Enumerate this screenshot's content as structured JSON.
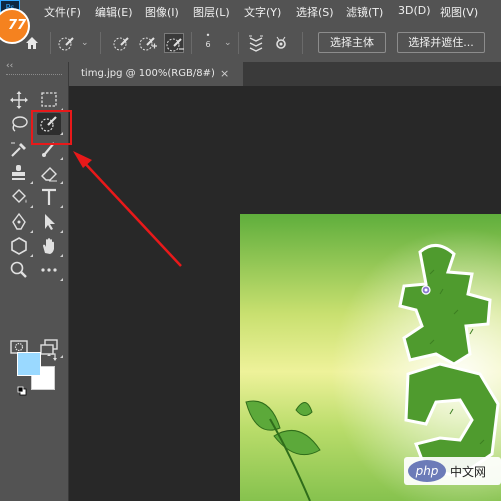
{
  "app": {
    "logo_text": "Ps",
    "badge_text": "77"
  },
  "menu": {
    "items": [
      "文件(F)",
      "编辑(E)",
      "图像(I)",
      "图层(L)",
      "文字(Y)",
      "选择(S)",
      "滤镜(T)",
      "3D(D)",
      "视图(V)"
    ]
  },
  "options": {
    "brush_size": "6",
    "select_subject_label": "选择主体",
    "select_mask_label": "选择并遮住..."
  },
  "toolbar": {
    "collapse_label": "‹‹",
    "selected_tool": "quick-selection-tool",
    "foreground_color": "#9ad9ff",
    "background_color": "#ffffff",
    "highlight_color": "#e8191a"
  },
  "document": {
    "tab_label": "timg.jpg @ 100%(RGB/8#)",
    "close_symbol": "×"
  },
  "watermark": {
    "logo_text": "php",
    "site_text": "中文网"
  }
}
